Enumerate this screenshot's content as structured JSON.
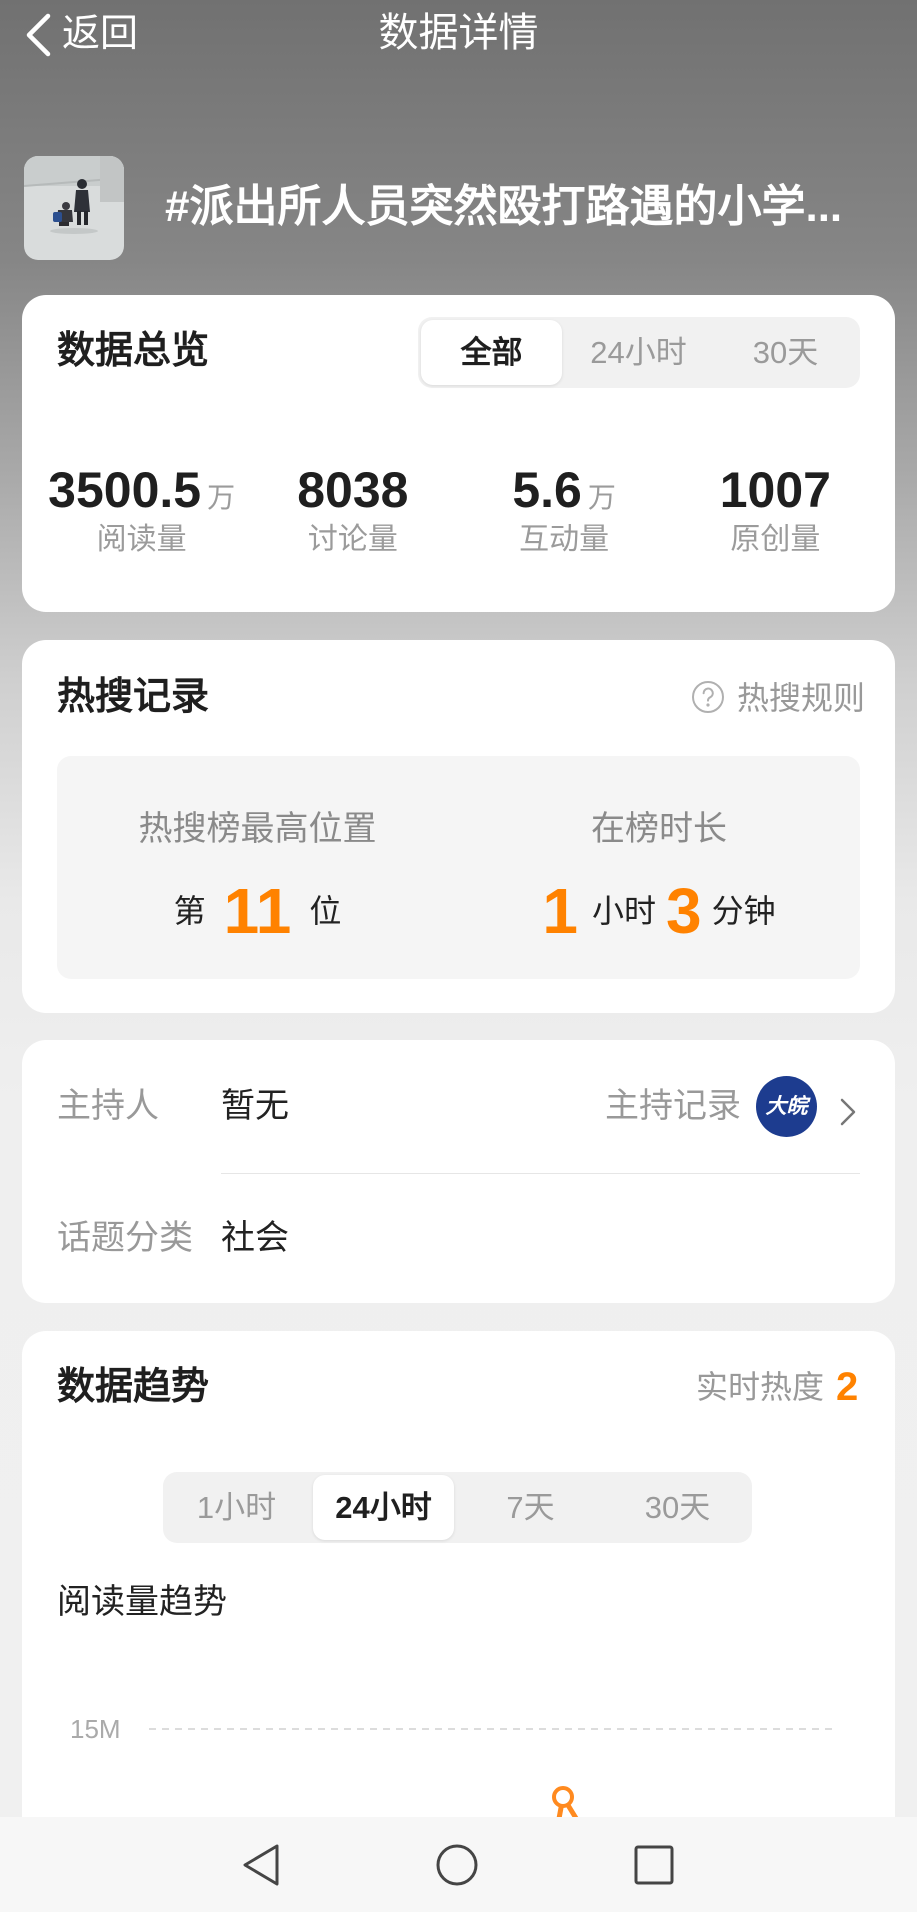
{
  "header": {
    "back_label": "返回",
    "title": "数据详情",
    "back_icon": "chevron-left-icon"
  },
  "topic": {
    "title": "#派出所人员突然殴打路遇的小学..."
  },
  "overview": {
    "title": "数据总览",
    "tabs": [
      "全部",
      "24小时",
      "30天"
    ],
    "selected_index": 0,
    "stats": [
      {
        "value": "3500.5",
        "unit": "万",
        "label": "阅读量"
      },
      {
        "value": "8038",
        "unit": "",
        "label": "讨论量"
      },
      {
        "value": "5.6",
        "unit": "万",
        "label": "互动量"
      },
      {
        "value": "1007",
        "unit": "",
        "label": "原创量"
      }
    ]
  },
  "hot_search": {
    "title": "热搜记录",
    "rules_label": "热搜规则",
    "rules_icon": "question-circle-icon",
    "best_position": {
      "label": "热搜榜最高位置",
      "prefix": "第",
      "value": "11",
      "suffix": "位"
    },
    "duration": {
      "label": "在榜时长",
      "hours": "1",
      "hours_unit": "小时",
      "minutes": "3",
      "minutes_unit": "分钟"
    }
  },
  "info": {
    "host_label": "主持人",
    "host_value": "暂无",
    "host_record_label": "主持记录",
    "host_avatar_text": "大皖",
    "category_label": "话题分类",
    "category_value": "社会"
  },
  "trend": {
    "title": "数据趋势",
    "realtime_label": "实时热度",
    "realtime_value": "2",
    "tabs": [
      "1小时",
      "24小时",
      "7天",
      "30天"
    ],
    "selected_index": 1,
    "chart_title": "阅读量趋势"
  },
  "chart_data": {
    "type": "line",
    "y_tick_labels": [
      "15M"
    ],
    "grid": true
  },
  "nav": {
    "icons": [
      "back-triangle-icon",
      "home-circle-icon",
      "recents-square-icon"
    ]
  },
  "colors": {
    "accent": "#ff8200",
    "avatar_bg": "#1d3c8f",
    "muted_text": "#999999"
  }
}
